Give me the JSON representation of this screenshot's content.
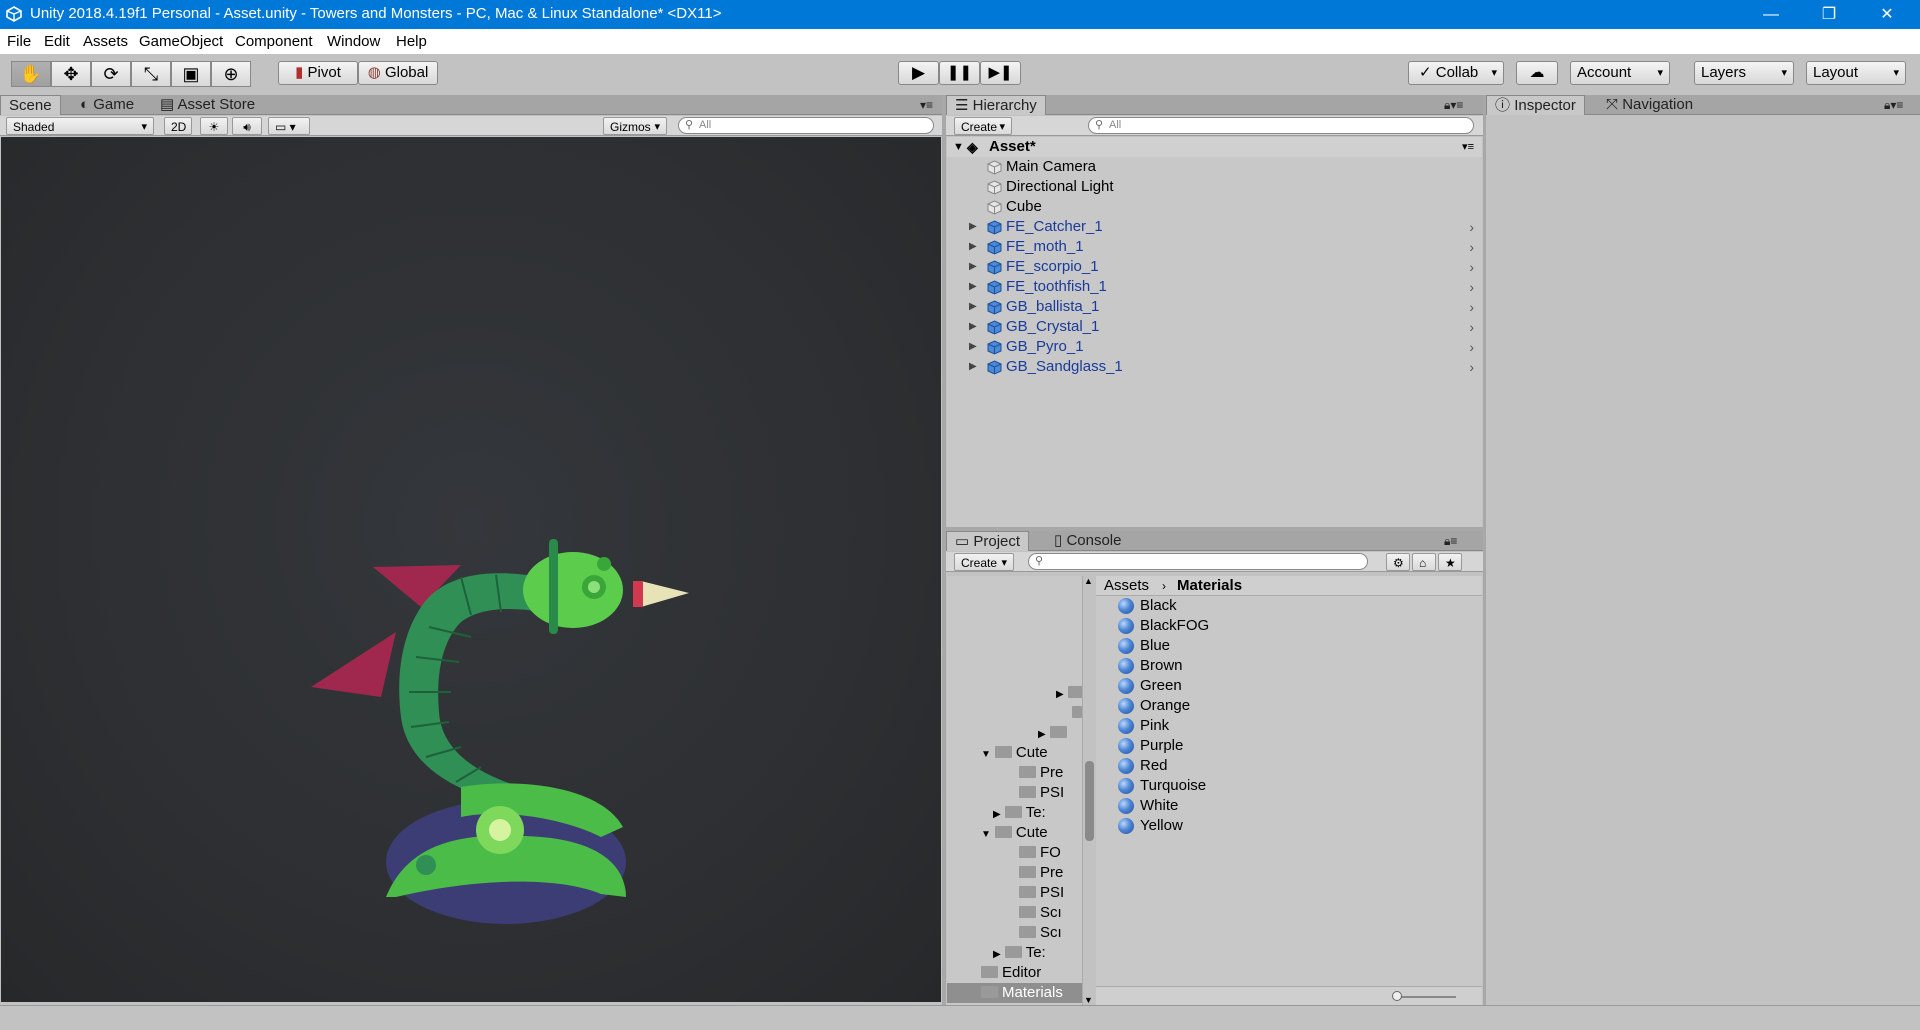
{
  "window": {
    "title": "Unity 2018.4.19f1 Personal - Asset.unity - Towers and Monsters - PC, Mac & Linux Standalone* <DX11>",
    "minimize": "—",
    "restore": "❐",
    "close": "✕"
  },
  "menu": [
    "File",
    "Edit",
    "Assets",
    "GameObject",
    "Component",
    "Window",
    "Help"
  ],
  "toolbar": {
    "pivot": "Pivot",
    "global": "Global",
    "collab": "Collab",
    "account": "Account",
    "layers": "Layers",
    "layout": "Layout"
  },
  "scene_panel": {
    "tabs": [
      "Scene",
      "Game",
      "Asset Store"
    ],
    "shading": "Shaded",
    "mode_2d": "2D",
    "gizmos": "Gizmos",
    "search_placeholder": "All"
  },
  "hierarchy": {
    "tab": "Hierarchy",
    "create": "Create",
    "search_placeholder": "All",
    "scene_name": "Asset*",
    "items": [
      {
        "name": "Main Camera",
        "prefab": false
      },
      {
        "name": "Directional Light",
        "prefab": false
      },
      {
        "name": "Cube",
        "prefab": false
      },
      {
        "name": "FE_Catcher_1",
        "prefab": true
      },
      {
        "name": "FE_moth_1",
        "prefab": true
      },
      {
        "name": "FE_scorpio_1",
        "prefab": true
      },
      {
        "name": "FE_toothfish_1",
        "prefab": true
      },
      {
        "name": "GB_ballista_1",
        "prefab": true
      },
      {
        "name": "GB_Crystal_1",
        "prefab": true
      },
      {
        "name": "GB_Pyro_1",
        "prefab": true
      },
      {
        "name": "GB_Sandglass_1",
        "prefab": true
      }
    ]
  },
  "project": {
    "tabs": [
      "Project",
      "Console"
    ],
    "create": "Create",
    "breadcrumb": [
      "Assets",
      "Materials"
    ],
    "tree": [
      {
        "label": "Cute",
        "expanded": true
      },
      {
        "label": "Pre"
      },
      {
        "label": "PSI"
      },
      {
        "label": "Te:"
      },
      {
        "label": "Cute",
        "expanded": true
      },
      {
        "label": "FO"
      },
      {
        "label": "Pre"
      },
      {
        "label": "PSI"
      },
      {
        "label": "Scı"
      },
      {
        "label": "Scı"
      },
      {
        "label": "Te:"
      },
      {
        "label": "Editor"
      },
      {
        "label": "Materials",
        "selected": true
      }
    ],
    "materials": [
      "Black",
      "BlackFOG",
      "Blue",
      "Brown",
      "Green",
      "Orange",
      "Pink",
      "Purple",
      "Red",
      "Turquoise",
      "White",
      "Yellow"
    ]
  },
  "inspector": {
    "tabs": [
      "Inspector",
      "Navigation"
    ]
  }
}
